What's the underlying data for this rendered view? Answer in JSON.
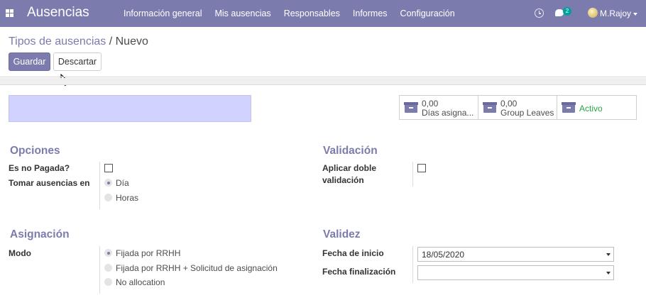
{
  "navbar": {
    "app_name": "Ausencias",
    "menu": [
      "Información general",
      "Mis ausencias",
      "Responsables",
      "Informes",
      "Configuración"
    ],
    "chat_count": "2",
    "user": "M.Rajoy"
  },
  "breadcrumb": {
    "parent": "Tipos de ausencias",
    "separator": "/",
    "current": "Nuevo"
  },
  "actions": {
    "save_label": "Guardar",
    "discard_label": "Descartar"
  },
  "smart_buttons": [
    {
      "value": "0,00",
      "label": "Días asigna..."
    },
    {
      "value": "0,00",
      "label": "Group Leaves"
    },
    {
      "label": "Activo"
    }
  ],
  "opciones": {
    "title": "Opciones",
    "unpaid_label": "Es no Pagada?",
    "take_label": "Tomar ausencias en",
    "take_options": [
      "Día",
      "Horas"
    ],
    "take_selected": "Día"
  },
  "validacion": {
    "title": "Validación",
    "double_label_line1": "Aplicar doble",
    "double_label_line2": "validación"
  },
  "asignacion": {
    "title": "Asignación",
    "mode_label": "Modo",
    "mode_options": [
      "Fijada por RRHH",
      "Fijada por RRHH + Solicitud de asignación",
      "No allocation"
    ],
    "mode_selected": "Fijada por RRHH"
  },
  "validez": {
    "title": "Validez",
    "start_label": "Fecha de inicio",
    "start_value": "18/05/2020",
    "end_label": "Fecha finalización",
    "end_value": ""
  },
  "colors": {
    "brand": "#7c7bad",
    "name_field": "#d2d2ff",
    "active": "#28a745"
  }
}
